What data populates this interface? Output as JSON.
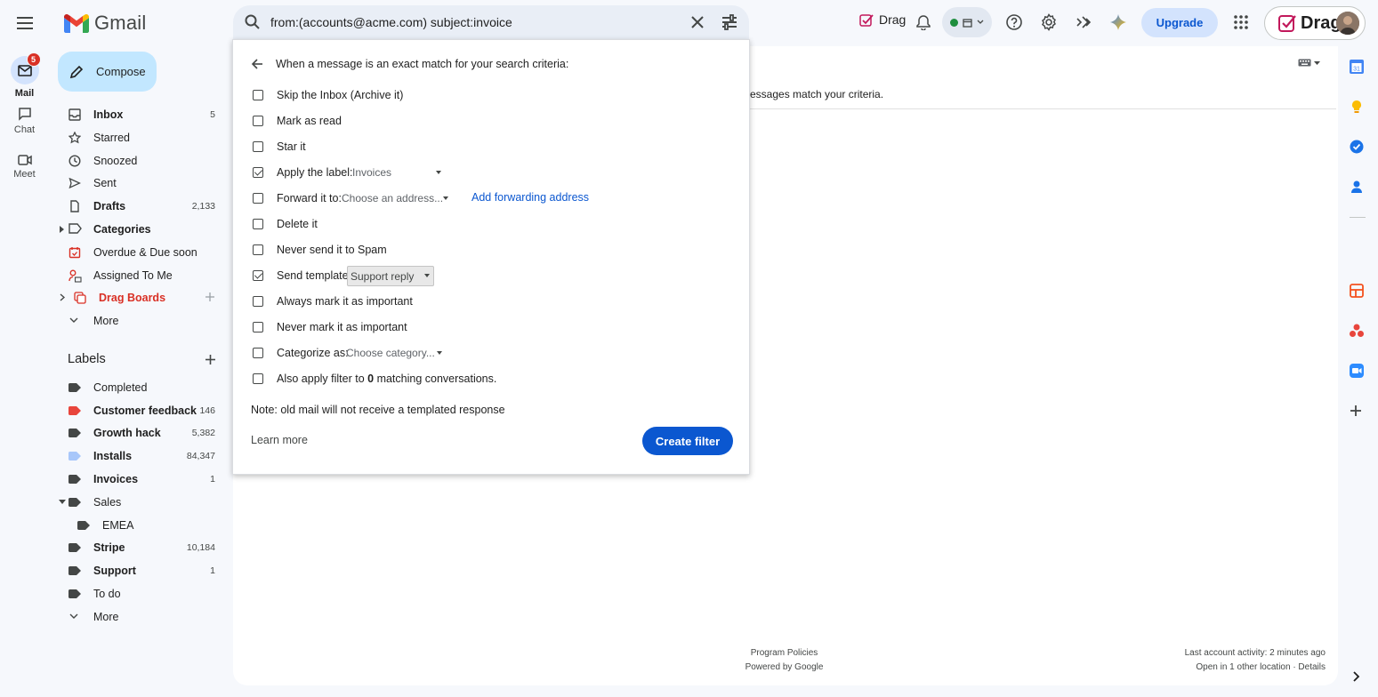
{
  "app": {
    "name": "Gmail"
  },
  "search": {
    "value": "from:(accounts@acme.com) subject:invoice"
  },
  "topbar": {
    "drag_label": "Drag",
    "upgrade_label": "Upgrade",
    "account_label": "Drag"
  },
  "rail": {
    "mail_label": "Mail",
    "mail_badge": "5",
    "chat_label": "Chat",
    "meet_label": "Meet"
  },
  "compose_label": "Compose",
  "nav": [
    {
      "label": "Inbox",
      "count": "5",
      "bold": true
    },
    {
      "label": "Starred",
      "count": ""
    },
    {
      "label": "Snoozed",
      "count": ""
    },
    {
      "label": "Sent",
      "count": ""
    },
    {
      "label": "Drafts",
      "count": "2,133",
      "bold": true
    },
    {
      "label": "Categories",
      "count": "",
      "bold": true
    },
    {
      "label": "Overdue & Due soon",
      "count": ""
    },
    {
      "label": "Assigned To Me",
      "count": ""
    },
    {
      "label": "Drag Boards",
      "count": ""
    },
    {
      "label": "More",
      "count": ""
    }
  ],
  "labels": {
    "title": "Labels",
    "items": [
      {
        "label": "Completed",
        "count": "",
        "color": "#444746"
      },
      {
        "label": "Customer feedback",
        "count": "146",
        "color": "#e8453c",
        "bold": true
      },
      {
        "label": "Growth hack",
        "count": "5,382",
        "color": "#444746",
        "bold": true
      },
      {
        "label": "Installs",
        "count": "84,347",
        "color": "#a8c7fa",
        "bold": true
      },
      {
        "label": "Invoices",
        "count": "1",
        "color": "#444746",
        "bold": true
      },
      {
        "label": "Sales",
        "count": "",
        "color": "#444746"
      },
      {
        "label": "EMEA",
        "count": "",
        "color": "#444746"
      },
      {
        "label": "Stripe",
        "count": "10,184",
        "color": "#444746",
        "bold": true
      },
      {
        "label": "Support",
        "count": "1",
        "color": "#444746",
        "bold": true
      },
      {
        "label": "To do",
        "count": "",
        "color": "#444746"
      },
      {
        "label": "More",
        "count": ""
      }
    ]
  },
  "main": {
    "match_text": "essages match your criteria.",
    "footer_policies": "Program Policies",
    "footer_powered": "Powered by Google",
    "footer_activity": "Last account activity: 2 minutes ago",
    "footer_location": "Open in 1 other location · Details"
  },
  "filter_dialog": {
    "header": "When a message is an exact match for your search criteria:",
    "options": [
      {
        "label": "Skip the Inbox (Archive it)",
        "checked": false
      },
      {
        "label": "Mark as read",
        "checked": false
      },
      {
        "label": "Star it",
        "checked": false
      },
      {
        "label": "Apply the label:",
        "checked": true,
        "dropdown": "Invoices"
      },
      {
        "label": "Forward it to:",
        "checked": false,
        "dropdown": "Choose an address...",
        "link": "Add forwarding address"
      },
      {
        "label": "Delete it",
        "checked": false
      },
      {
        "label": "Never send it to Spam",
        "checked": false
      },
      {
        "label": "Send template:",
        "checked": true,
        "dropdown": "Support reply"
      },
      {
        "label": "Always mark it as important",
        "checked": false
      },
      {
        "label": "Never mark it as important",
        "checked": false
      },
      {
        "label": "Categorize as:",
        "checked": false,
        "dropdown": "Choose category..."
      },
      {
        "label_prefix": "Also apply filter to ",
        "label_count": "0",
        "label_suffix": " matching conversations.",
        "checked": false
      }
    ],
    "note": "Note: old mail will not receive a templated response",
    "learn_more": "Learn more",
    "create_button": "Create filter"
  },
  "colors": {
    "accent": "#0b57d0",
    "compose_bg": "#c2e7ff",
    "upgrade_bg": "#d3e3fd",
    "badge_red": "#d93025"
  }
}
